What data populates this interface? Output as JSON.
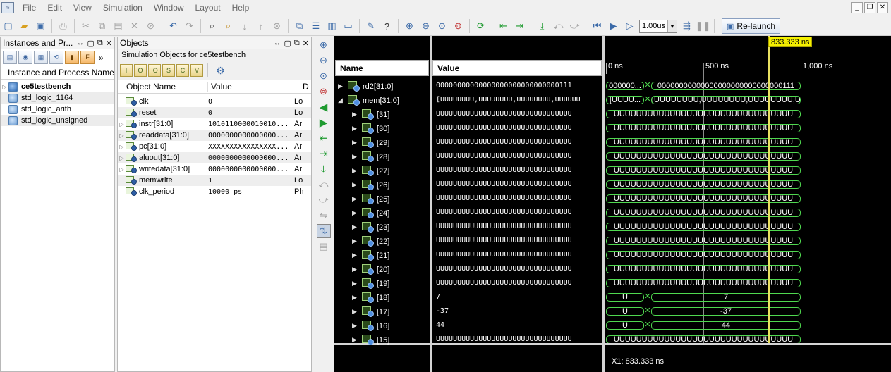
{
  "menubar": {
    "items": [
      "File",
      "Edit",
      "View",
      "Simulation",
      "Window",
      "Layout",
      "Help"
    ]
  },
  "toolbar": {
    "time_value": "1.00us",
    "relaunch_label": "Re-launch"
  },
  "instances_panel": {
    "title": "Instances and Pr...",
    "more": "»",
    "column_header": "Instance and Process Name",
    "items": [
      {
        "label": "ce5testbench",
        "bold": true,
        "expander": true
      },
      {
        "label": "std_logic_1164",
        "bold": false,
        "expander": false
      },
      {
        "label": "std_logic_arith",
        "bold": false,
        "expander": false
      },
      {
        "label": "std_logic_unsigned",
        "bold": false,
        "expander": false
      }
    ]
  },
  "objects_panel": {
    "title": "Objects",
    "subtitle": "Simulation Objects for ce5testbench",
    "headers": {
      "name": "Object Name",
      "value": "Value",
      "type": "D"
    },
    "rows": [
      {
        "name": "clk",
        "value": "0",
        "type": "Lo",
        "expander": false
      },
      {
        "name": "reset",
        "value": "0",
        "type": "Lo",
        "expander": false
      },
      {
        "name": "instr[31:0]",
        "value": "1010110000010010...",
        "type": "Ar",
        "expander": true
      },
      {
        "name": "readdata[31:0]",
        "value": "0000000000000000...",
        "type": "Ar",
        "expander": true
      },
      {
        "name": "pc[31:0]",
        "value": "XXXXXXXXXXXXXXXX...",
        "type": "Ar",
        "expander": true
      },
      {
        "name": "aluout[31:0]",
        "value": "0000000000000000...",
        "type": "Ar",
        "expander": true
      },
      {
        "name": "writedata[31:0]",
        "value": "0000000000000000...",
        "type": "Ar",
        "expander": true
      },
      {
        "name": "memwrite",
        "value": "1",
        "type": "Lo",
        "expander": false
      },
      {
        "name": "clk_period",
        "value": "10000 ps",
        "type": "Ph",
        "expander": false
      }
    ]
  },
  "wave": {
    "name_header": "Name",
    "value_header": "Value",
    "ticks": [
      "0 ns",
      "500 ns",
      "1,000 ns"
    ],
    "cursor_label": "833.333 ns",
    "cursor_readout": "X1: 833.333 ns",
    "rows": [
      {
        "name": "rd2[31:0]",
        "value": "00000000000000000000000000000111",
        "level": 0,
        "open": false,
        "seg_a": "000000...",
        "seg_b": "00000000000000000000000000000111",
        "kind": "good"
      },
      {
        "name": "mem[31:0]",
        "value": "[UUUUUUUU,UUUUUUUU,UUUUUUUU,UUUUUU",
        "level": 0,
        "open": true,
        "seg_a": "[UUUU...",
        "seg_b": "[UUUUUUUU,UUUUUUUU,UUUUUUUU,U...",
        "kind": "good"
      },
      {
        "name": "[31]",
        "value": "UUUUUUUUUUUUUUUUUUUUUUUUUUUUUUUU",
        "level": 1,
        "seg_full": "UUUUUUUUUUUUUUUUUUUUUUUUUUUUUUUU",
        "kind": "u"
      },
      {
        "name": "[30]",
        "value": "UUUUUUUUUUUUUUUUUUUUUUUUUUUUUUUU",
        "level": 1,
        "seg_full": "UUUUUUUUUUUUUUUUUUUUUUUUUUUUUUUU",
        "kind": "u"
      },
      {
        "name": "[29]",
        "value": "UUUUUUUUUUUUUUUUUUUUUUUUUUUUUUUU",
        "level": 1,
        "seg_full": "UUUUUUUUUUUUUUUUUUUUUUUUUUUUUUUU",
        "kind": "u"
      },
      {
        "name": "[28]",
        "value": "UUUUUUUUUUUUUUUUUUUUUUUUUUUUUUUU",
        "level": 1,
        "seg_full": "UUUUUUUUUUUUUUUUUUUUUUUUUUUUUUUU",
        "kind": "u"
      },
      {
        "name": "[27]",
        "value": "UUUUUUUUUUUUUUUUUUUUUUUUUUUUUUUU",
        "level": 1,
        "seg_full": "UUUUUUUUUUUUUUUUUUUUUUUUUUUUUUUU",
        "kind": "u"
      },
      {
        "name": "[26]",
        "value": "UUUUUUUUUUUUUUUUUUUUUUUUUUUUUUUU",
        "level": 1,
        "seg_full": "UUUUUUUUUUUUUUUUUUUUUUUUUUUUUUUU",
        "kind": "u"
      },
      {
        "name": "[25]",
        "value": "UUUUUUUUUUUUUUUUUUUUUUUUUUUUUUUU",
        "level": 1,
        "seg_full": "UUUUUUUUUUUUUUUUUUUUUUUUUUUUUUUU",
        "kind": "u"
      },
      {
        "name": "[24]",
        "value": "UUUUUUUUUUUUUUUUUUUUUUUUUUUUUUUU",
        "level": 1,
        "seg_full": "UUUUUUUUUUUUUUUUUUUUUUUUUUUUUUUU",
        "kind": "u"
      },
      {
        "name": "[23]",
        "value": "UUUUUUUUUUUUUUUUUUUUUUUUUUUUUUUU",
        "level": 1,
        "seg_full": "UUUUUUUUUUUUUUUUUUUUUUUUUUUUUUUU",
        "kind": "u"
      },
      {
        "name": "[22]",
        "value": "UUUUUUUUUUUUUUUUUUUUUUUUUUUUUUUU",
        "level": 1,
        "seg_full": "UUUUUUUUUUUUUUUUUUUUUUUUUUUUUUUU",
        "kind": "u"
      },
      {
        "name": "[21]",
        "value": "UUUUUUUUUUUUUUUUUUUUUUUUUUUUUUUU",
        "level": 1,
        "seg_full": "UUUUUUUUUUUUUUUUUUUUUUUUUUUUUUUU",
        "kind": "u"
      },
      {
        "name": "[20]",
        "value": "UUUUUUUUUUUUUUUUUUUUUUUUUUUUUUUU",
        "level": 1,
        "seg_full": "UUUUUUUUUUUUUUUUUUUUUUUUUUUUUUUU",
        "kind": "u"
      },
      {
        "name": "[19]",
        "value": "UUUUUUUUUUUUUUUUUUUUUUUUUUUUUUUU",
        "level": 1,
        "seg_full": "UUUUUUUUUUUUUUUUUUUUUUUUUUUUUUUU",
        "kind": "u"
      },
      {
        "name": "[18]",
        "value": "7",
        "level": 1,
        "seg_a": "U",
        "seg_b": "7",
        "kind": "good"
      },
      {
        "name": "[17]",
        "value": "-37",
        "level": 1,
        "seg_a": "U",
        "seg_b": "-37",
        "kind": "good"
      },
      {
        "name": "[16]",
        "value": "44",
        "level": 1,
        "seg_a": "U",
        "seg_b": "44",
        "kind": "good"
      },
      {
        "name": "[15]",
        "value": "UUUUUUUUUUUUUUUUUUUUUUUUUUUUUUUU",
        "level": 1,
        "seg_full": "UUUUUUUUUUUUUUUUUUUUUUUUUUUUUUUU",
        "kind": "u"
      }
    ]
  }
}
